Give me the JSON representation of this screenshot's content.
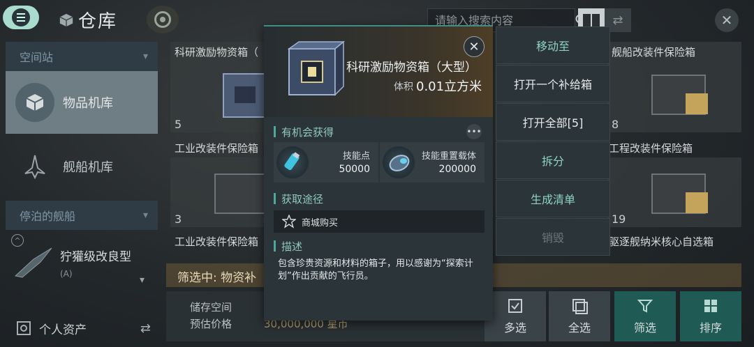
{
  "header": {
    "title": "仓库",
    "search_placeholder": "请输入搜索内容"
  },
  "sidebar": {
    "section_station": "空间站",
    "item_hangar": "物品机库",
    "item_ship_hangar": "舰船机库",
    "section_docked": "停泊的舰船",
    "ship_name": "狞獾级改良型",
    "ship_sub": "(A)",
    "personal_assets": "个人资产"
  },
  "grid": {
    "card1_name": "科研激励物资箱（",
    "card1_count": "5",
    "card2_name": "舰船改装件保险箱",
    "card2_count": "8",
    "row2_left": "工业改装件保险箱",
    "row2_right": "工程改装件保险箱",
    "card3_count": "3",
    "card4_count": "19",
    "row3_left": "工业改装件保险箱",
    "row3_right": "驱逐舰纳米核心自选箱"
  },
  "filter": {
    "label": "筛选中: 物资补"
  },
  "bottom": {
    "storage_label": "储存空间",
    "price_label": "预估价格",
    "price_value": "30,000,000 星币"
  },
  "actions": {
    "multi_select": "多选",
    "select_all": "全选",
    "filter": "筛选",
    "sort": "排序"
  },
  "popup": {
    "item_name": "科研激励物资箱（大型）",
    "volume_label": "体积",
    "volume_value": "0.01立方米",
    "section_rewards": "有机会获得",
    "reward1_name": "技能点",
    "reward1_value": "50000",
    "reward2_name": "技能重置载体",
    "reward2_value": "200000",
    "section_source": "获取途径",
    "source1": "商城购买",
    "section_desc": "描述",
    "description": "包含珍贵资源和材料的箱子，用以感谢为“探索计划”作出贡献的飞行员。"
  },
  "context_menu": {
    "move_to": "移动至",
    "open_one": "打开一个补给箱",
    "open_all": "打开全部[5]",
    "dismantle": "拆分",
    "create_list": "生成清单",
    "destroy": "销毁"
  },
  "colors": {
    "accent": "#4ea79b",
    "menu_button": "#a9dccd",
    "highlight_action": "#1f5a55"
  },
  "icons": [
    "menu-icon",
    "cube-icon",
    "radar-icon",
    "search-icon",
    "grid-view-icon",
    "swap-icon",
    "close-icon",
    "more-icon",
    "shop-icon",
    "checkbox-icon",
    "filter-icon",
    "sort-icon"
  ]
}
